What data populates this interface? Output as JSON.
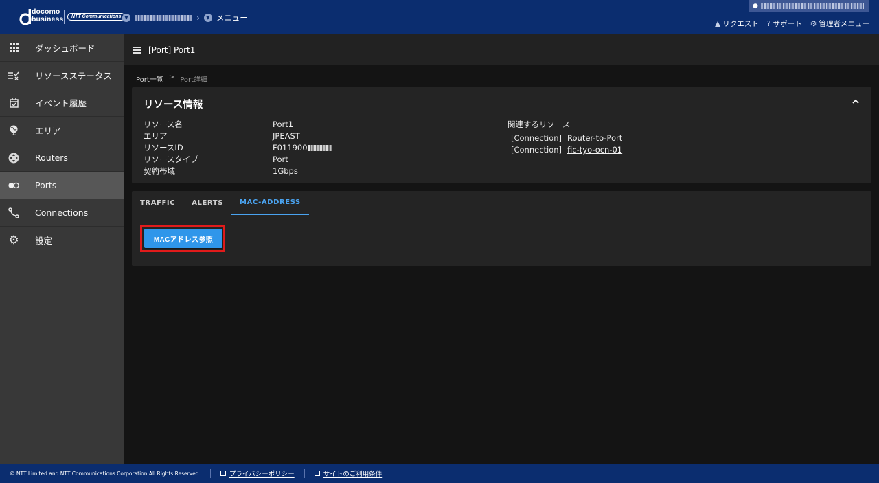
{
  "header": {
    "brand_line1": "docomo",
    "brand_line2": "business",
    "brand_ntt": "NTT Communications",
    "menu_label": "メニュー",
    "links": {
      "request": "リクエスト",
      "support": "サポート",
      "admin": "管理者メニュー"
    }
  },
  "sidebar": {
    "items": [
      {
        "label": "ダッシュボード",
        "icon": "grid-icon"
      },
      {
        "label": "リソースステータス",
        "icon": "checklist-icon"
      },
      {
        "label": "イベント履歴",
        "icon": "calendar-check-icon"
      },
      {
        "label": "エリア",
        "icon": "globe-icon"
      },
      {
        "label": "Routers",
        "icon": "router-icon"
      },
      {
        "label": "Ports",
        "icon": "toggle-icon"
      },
      {
        "label": "Connections",
        "icon": "connection-icon"
      },
      {
        "label": "設定",
        "icon": "gear-icon"
      }
    ],
    "active_index": 5
  },
  "page": {
    "title": "[Port] Port1",
    "breadcrumb": {
      "parent": "Port一覧",
      "separator": ">",
      "current": "Port詳細"
    }
  },
  "resource_info": {
    "heading": "リソース情報",
    "fields": [
      {
        "key": "リソース名",
        "value": "Port1"
      },
      {
        "key": "エリア",
        "value": "JPEAST"
      },
      {
        "key": "リソースID",
        "value": "F011900"
      },
      {
        "key": "リソースタイプ",
        "value": "Port"
      },
      {
        "key": "契約帯域",
        "value": "1Gbps"
      }
    ],
    "related_title": "関連するリソース",
    "related": [
      {
        "type": "[Connection]",
        "name": "Router-to-Port"
      },
      {
        "type": "[Connection]",
        "name": "fic-tyo-ocn-01"
      }
    ]
  },
  "tabs": {
    "items": [
      "TRAFFIC",
      "ALERTS",
      "MAC-ADDRESS"
    ],
    "active_index": 2
  },
  "mac_button_label": "MACアドレス参照",
  "footer": {
    "copyright": "© NTT Limited and NTT Communications Corporation All Rights Reserved.",
    "privacy": "プライバシーポリシー",
    "terms": "サイトのご利用条件"
  },
  "colors": {
    "header_bg": "#0b2d6f",
    "accent": "#2f96ea",
    "highlight": "#e11b1b"
  }
}
